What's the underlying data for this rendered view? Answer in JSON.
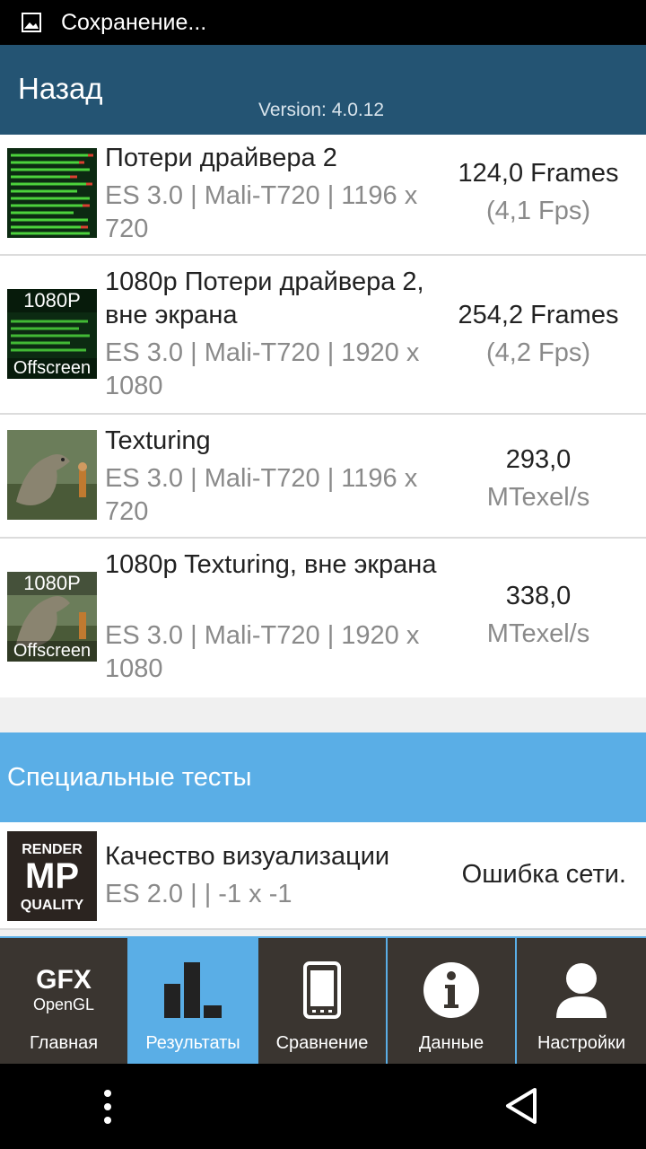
{
  "status_bar": {
    "text": "Сохранение...",
    "icon": "image-icon"
  },
  "header": {
    "back_label": "Назад",
    "version": "Version: 4.0.12"
  },
  "results": [
    {
      "title": "Потери драйвера 2",
      "subtitle": "ES 3.0 | Mali-T720 | 1196 x 720",
      "score": "124,0 Frames",
      "unit": "(4,1 Fps)",
      "thumb": "driver-overhead-thumbnail"
    },
    {
      "title": "1080p Потери драйвера 2, вне экрана",
      "subtitle": "ES 3.0 | Mali-T720 | 1920 x 1080",
      "score": "254,2 Frames",
      "unit": "(4,2 Fps)",
      "thumb": "driver-overhead-offscreen-thumbnail",
      "badge_top": "1080P",
      "badge_bottom": "Offscreen"
    },
    {
      "title": "Texturing",
      "subtitle": "ES 3.0 | Mali-T720 | 1196 x 720",
      "score": "293,0",
      "unit": "MTexel/s",
      "thumb": "dinosaur-thumbnail"
    },
    {
      "title": "1080p Texturing, вне экрана",
      "subtitle": "ES 3.0 | Mali-T720 | 1920 x 1080",
      "score": "338,0",
      "unit": "MTexel/s",
      "thumb": "dinosaur-offscreen-thumbnail",
      "badge_top": "1080P",
      "badge_bottom": "Offscreen"
    }
  ],
  "special": {
    "header": "Специальные тесты",
    "item": {
      "title": "Качество визуализации",
      "subtitle": "ES 2.0 |  | -1 x -1",
      "status": "Ошибка сети.",
      "thumb_line1": "RENDER",
      "thumb_line2": "MP",
      "thumb_line3": "QUALITY"
    }
  },
  "tabs": [
    {
      "label": "Главная",
      "icon": "gfx-logo-icon",
      "logo_main": "GFX",
      "logo_sub": "OpenGL"
    },
    {
      "label": "Результаты",
      "icon": "bar-chart-icon",
      "active": true
    },
    {
      "label": "Сравнение",
      "icon": "phone-icon"
    },
    {
      "label": "Данные",
      "icon": "info-icon"
    },
    {
      "label": "Настройки",
      "icon": "user-icon"
    }
  ],
  "colors": {
    "header_bg": "#245473",
    "accent": "#5aaee6",
    "tab_bg": "#3a3530"
  }
}
